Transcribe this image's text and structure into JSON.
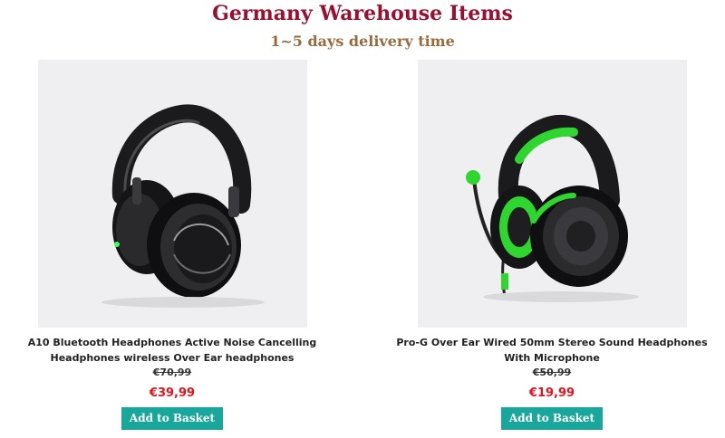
{
  "header": {
    "title": "Germany Warehouse Items",
    "subtitle": "1~5 days delivery time"
  },
  "products": [
    {
      "title": "A10 Bluetooth Headphones Active Noise Cancelling Headphones wireless Over Ear headphones",
      "old_price": "€70,99",
      "price": "€39,99",
      "button_label": "Add to Basket",
      "image_icon": "black-over-ear-headphones"
    },
    {
      "title": "Pro-G Over Ear Wired 50mm Stereo Sound Headphones With Microphone",
      "old_price": "€50,99",
      "price": "€19,99",
      "button_label": "Add to Basket",
      "image_icon": "green-gaming-headset"
    }
  ],
  "colors": {
    "heading": "#9b1030",
    "subheading": "#9a6a3c",
    "price": "#e3141d",
    "button": "#18a79a",
    "accent_green": "#2fd62f"
  }
}
